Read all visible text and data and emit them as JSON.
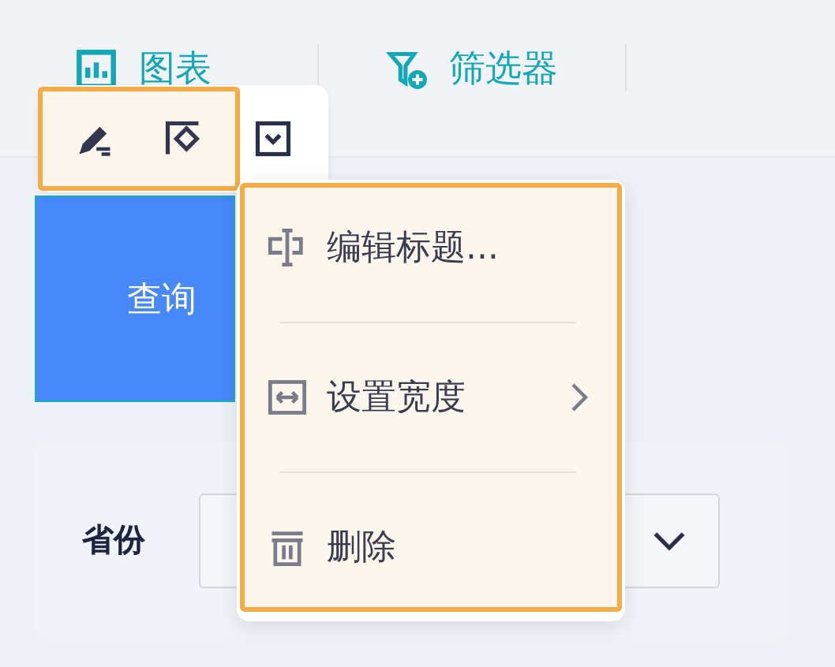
{
  "tabs": [
    {
      "label": "图表",
      "kind": "chart"
    },
    {
      "label": "筛选器",
      "kind": "filter"
    }
  ],
  "toolbar": {
    "highlighted": true
  },
  "query_button": {
    "label": "查询"
  },
  "filter": {
    "label": "省份"
  },
  "context_menu": {
    "highlighted": true,
    "items": [
      {
        "label": "编辑标题...",
        "kind": "title",
        "submenu": false
      },
      {
        "label": "设置宽度",
        "kind": "width",
        "submenu": true
      },
      {
        "label": "删除",
        "kind": "trash",
        "submenu": false
      }
    ]
  }
}
